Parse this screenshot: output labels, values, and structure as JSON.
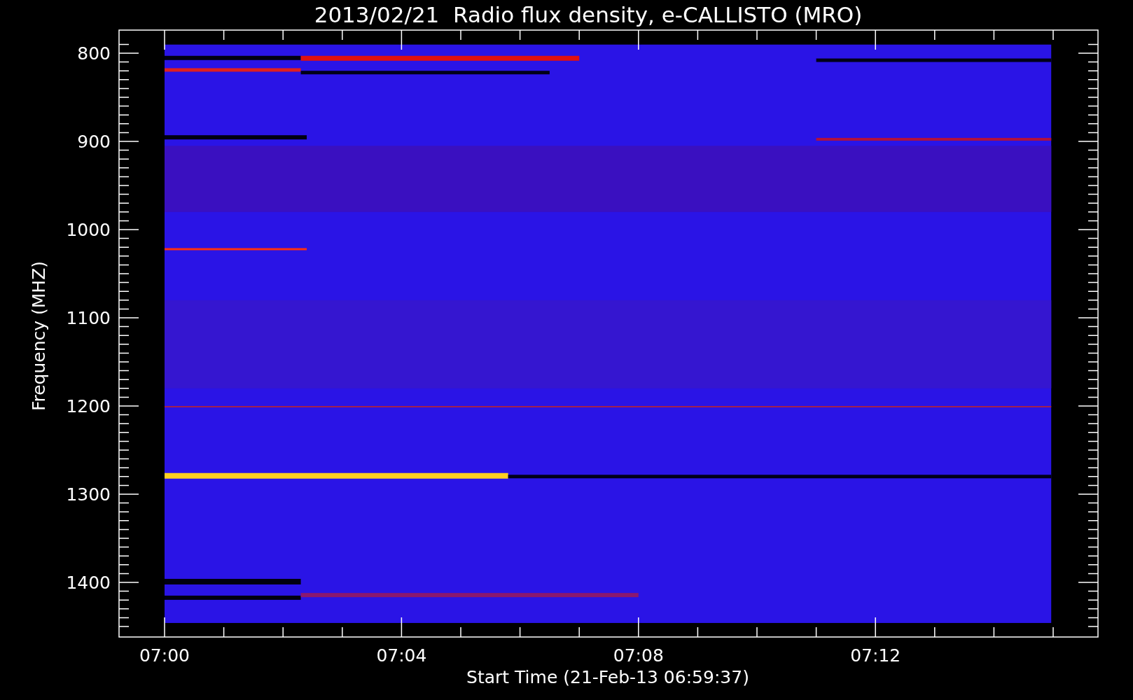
{
  "plot": {
    "title": "2013/02/21  Radio flux density, e-CALLISTO (MRO)",
    "xlabel": "Start Time (21-Feb-13 06:59:37)",
    "ylabel": "Frequency (MHZ)",
    "y_tick_labels": [
      "800",
      "900",
      "1000",
      "1100",
      "1200",
      "1300",
      "1400"
    ],
    "x_tick_labels": [
      "07:00",
      "07:04",
      "07:08",
      "07:12"
    ]
  }
}
